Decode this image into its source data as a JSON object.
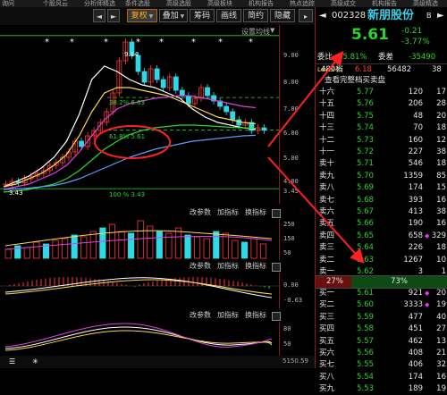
{
  "menu": [
    "询问",
    "个股风云",
    "分析师精选",
    "条件选股",
    "高级选股",
    "高级板块",
    "机构报告",
    "热点追踪",
    "高级成交",
    "机构报告",
    "高级精选"
  ],
  "toolbar": {
    "buttons": [
      {
        "label": "复权",
        "active": true,
        "arrow": true
      },
      {
        "label": "叠加",
        "arrow": true
      },
      {
        "label": "筹码"
      },
      {
        "label": "画线"
      },
      {
        "label": "简约"
      },
      {
        "label": "隐藏"
      }
    ],
    "nav": [
      "◄",
      "►"
    ]
  },
  "chart": {
    "setting_label": "设置均线",
    "y_labels": [
      "9.00",
      "8.00",
      "7.00",
      "6.00",
      "5.00",
      "4.00",
      "3.45"
    ],
    "annotations": {
      "high": "9.14",
      "low": "3.43",
      "fib38": "38.2% 6.83",
      "fib61": "61.8% 5.61",
      "fib100": "100 % 3.43"
    },
    "stars": [
      "*",
      "*",
      "*",
      "*",
      "*",
      "*",
      "*",
      "*"
    ],
    "volume_sub": {
      "labels": [
        "改参数",
        "加指标",
        "换指标"
      ],
      "y_labels": [
        "250",
        "150",
        "50"
      ]
    },
    "macd_sub": {
      "labels": [
        "改参数",
        "加指标",
        "换指标"
      ],
      "y_labels": [
        "0.00",
        "-0.63"
      ]
    },
    "kdj_sub": {
      "labels": [
        "改参数",
        "加指标",
        "换指标"
      ],
      "y_labels": [
        "80",
        "50"
      ]
    },
    "bottom_label": "5150.59"
  },
  "stock": {
    "code": "002328",
    "name": "新朋股份",
    "tag": "B",
    "price": "5.61",
    "change": "-0.21",
    "pct": "-3.77%",
    "weibi_label": "委比",
    "weibi": "-45.81%",
    "weicha_label": "委差",
    "weicha": "-35490",
    "level_label": "Level-2",
    "bid_tab": "480档",
    "tab_price": "6.18",
    "tab_vol": "56482",
    "tab_cnt": "38",
    "detail_button": "查看完整档买卖盘",
    "ratio_left": "27%",
    "ratio_right": "73%"
  },
  "sell_levels": [
    {
      "label": "十六",
      "price": "5.77",
      "vol": "120",
      "cnt": "17"
    },
    {
      "label": "十五",
      "price": "5.76",
      "vol": "206",
      "cnt": "28"
    },
    {
      "label": "十四",
      "price": "5.75",
      "vol": "48",
      "cnt": "20"
    },
    {
      "label": "十三",
      "price": "5.74",
      "vol": "70",
      "cnt": "18"
    },
    {
      "label": "十二",
      "price": "5.73",
      "vol": "160",
      "cnt": "12"
    },
    {
      "label": "十一",
      "price": "5.72",
      "vol": "227",
      "cnt": "38"
    },
    {
      "label": "卖十",
      "price": "5.71",
      "vol": "546",
      "cnt": "18"
    },
    {
      "label": "卖九",
      "price": "5.70",
      "vol": "1359",
      "cnt": "85"
    },
    {
      "label": "卖八",
      "price": "5.69",
      "vol": "174",
      "cnt": "15"
    },
    {
      "label": "卖七",
      "price": "5.68",
      "vol": "393",
      "cnt": "16"
    },
    {
      "label": "卖六",
      "price": "5.67",
      "vol": "413",
      "cnt": "38"
    },
    {
      "label": "卖五",
      "price": "5.66",
      "vol": "190",
      "cnt": "16"
    },
    {
      "label": "卖四",
      "price": "5.65",
      "vol": "658",
      "cnt": "329",
      "mark": true
    },
    {
      "label": "卖三",
      "price": "5.64",
      "vol": "226",
      "cnt": "18"
    },
    {
      "label": "卖二",
      "price": "5.63",
      "vol": "1267",
      "cnt": "10"
    },
    {
      "label": "卖一",
      "price": "5.62",
      "vol": "3",
      "cnt": "1"
    }
  ],
  "buy_levels": [
    {
      "label": "买一",
      "price": "5.61",
      "vol": "921",
      "cnt": "20",
      "mark": true
    },
    {
      "label": "买二",
      "price": "5.60",
      "vol": "3333",
      "cnt": "19",
      "mark": true
    },
    {
      "label": "买三",
      "price": "5.59",
      "vol": "477",
      "cnt": "40"
    },
    {
      "label": "买四",
      "price": "5.58",
      "vol": "451",
      "cnt": "27"
    },
    {
      "label": "买五",
      "price": "5.57",
      "vol": "462",
      "cnt": "13"
    },
    {
      "label": "买六",
      "price": "5.56",
      "vol": "408",
      "cnt": "21"
    },
    {
      "label": "买七",
      "price": "5.55",
      "vol": "406",
      "cnt": "32"
    },
    {
      "label": "买八",
      "price": "5.54",
      "vol": "174",
      "cnt": "16"
    },
    {
      "label": "买九",
      "price": "5.53",
      "vol": "189",
      "cnt": "19"
    }
  ],
  "colors": {
    "red": "#ff3838",
    "green": "#2bd52b",
    "yellow": "#ffd84a",
    "grid_red": "#8b1a1a"
  }
}
